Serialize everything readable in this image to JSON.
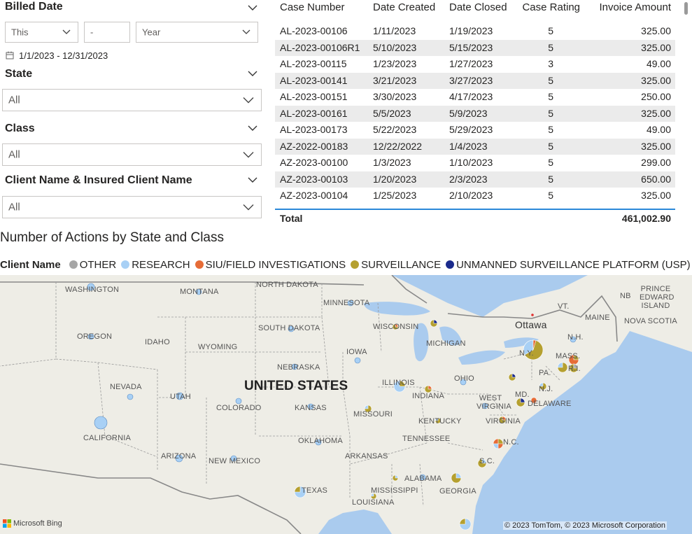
{
  "slicers": {
    "billed_date": {
      "title": "Billed Date",
      "relative": "This",
      "count": "-",
      "period": "Year",
      "range": "1/1/2023 - 12/31/2023"
    },
    "state": {
      "title": "State",
      "value": "All"
    },
    "class": {
      "title": "Class",
      "value": "All"
    },
    "client": {
      "title": "Client Name & Insured Client Name",
      "value": "All"
    }
  },
  "table": {
    "headers": [
      "Case Number",
      "Date Created",
      "Date Closed",
      "Case Rating",
      "Invoice Amount"
    ],
    "rows": [
      [
        "AL-2023-00106",
        "1/11/2023",
        "1/19/2023",
        "5",
        "325.00"
      ],
      [
        "AL-2023-00106R1",
        "5/10/2023",
        "5/15/2023",
        "5",
        "325.00"
      ],
      [
        "AL-2023-00115",
        "1/23/2023",
        "1/27/2023",
        "3",
        "49.00"
      ],
      [
        "AL-2023-00141",
        "3/21/2023",
        "3/27/2023",
        "5",
        "325.00"
      ],
      [
        "AL-2023-00151",
        "3/30/2023",
        "4/17/2023",
        "5",
        "250.00"
      ],
      [
        "AL-2023-00161",
        "5/5/2023",
        "5/9/2023",
        "5",
        "325.00"
      ],
      [
        "AL-2023-00173",
        "5/22/2023",
        "5/29/2023",
        "5",
        "49.00"
      ],
      [
        "AZ-2022-00183",
        "12/22/2022",
        "1/4/2023",
        "5",
        "325.00"
      ],
      [
        "AZ-2023-00100",
        "1/3/2023",
        "1/10/2023",
        "5",
        "299.00"
      ],
      [
        "AZ-2023-00103",
        "1/20/2023",
        "2/3/2023",
        "5",
        "650.00"
      ],
      [
        "AZ-2023-00104",
        "1/25/2023",
        "2/10/2023",
        "5",
        "325.00"
      ]
    ],
    "total_label": "Total",
    "total_value": "461,002.90"
  },
  "map_visual": {
    "title": "Number of Actions by State and Class",
    "legend_title": "Client Name",
    "legend": [
      {
        "label": "OTHER",
        "color": "#a6a6a6"
      },
      {
        "label": "RESEARCH",
        "color": "#a8d0f5"
      },
      {
        "label": "SIU/FIELD INVESTIGATIONS",
        "color": "#e66c37"
      },
      {
        "label": "SURVEILLANCE",
        "color": "#b5a030"
      },
      {
        "label": "UNMANNED SURVEILLANCE PLATFORM (USP)",
        "color": "#1a2a8c"
      }
    ],
    "country_label": "UNITED STATES",
    "place_labels": [
      "WASHINGTON",
      "MONTANA",
      "NORTH DAKOTA",
      "MINNESOTA",
      "PRINCE EDWARD ISLAND",
      "NB",
      "MAINE",
      "NOVA SCOTIA",
      "Ottawa",
      "VT.",
      "N.H.",
      "MASS.",
      "R.I.",
      "N.Y.",
      "WISCONSIN",
      "MICHIGAN",
      "SOUTH DAKOTA",
      "OREGON",
      "IDAHO",
      "WYOMING",
      "IOWA",
      "NEBRASKA",
      "NEVADA",
      "UTAH",
      "COLORADO",
      "KANSAS",
      "ILLINOIS",
      "INDIANA",
      "OHIO",
      "PA.",
      "N.J.",
      "MD.",
      "DELAWARE",
      "WEST VIRGINIA",
      "VIRGINIA",
      "KENTUCKY",
      "MISSOURI",
      "CALIFORNIA",
      "TENNESSEE",
      "N.C.",
      "S.C.",
      "OKLAHOMA",
      "ARKANSAS",
      "ARIZONA",
      "NEW MEXICO",
      "ALABAMA",
      "GEORGIA",
      "MISSISSIPPI",
      "LOUISIANA",
      "TEXAS"
    ],
    "attribution": "Microsoft Bing",
    "copyright": "© 2023 TomTom, © 2023 Microsoft Corporation"
  }
}
